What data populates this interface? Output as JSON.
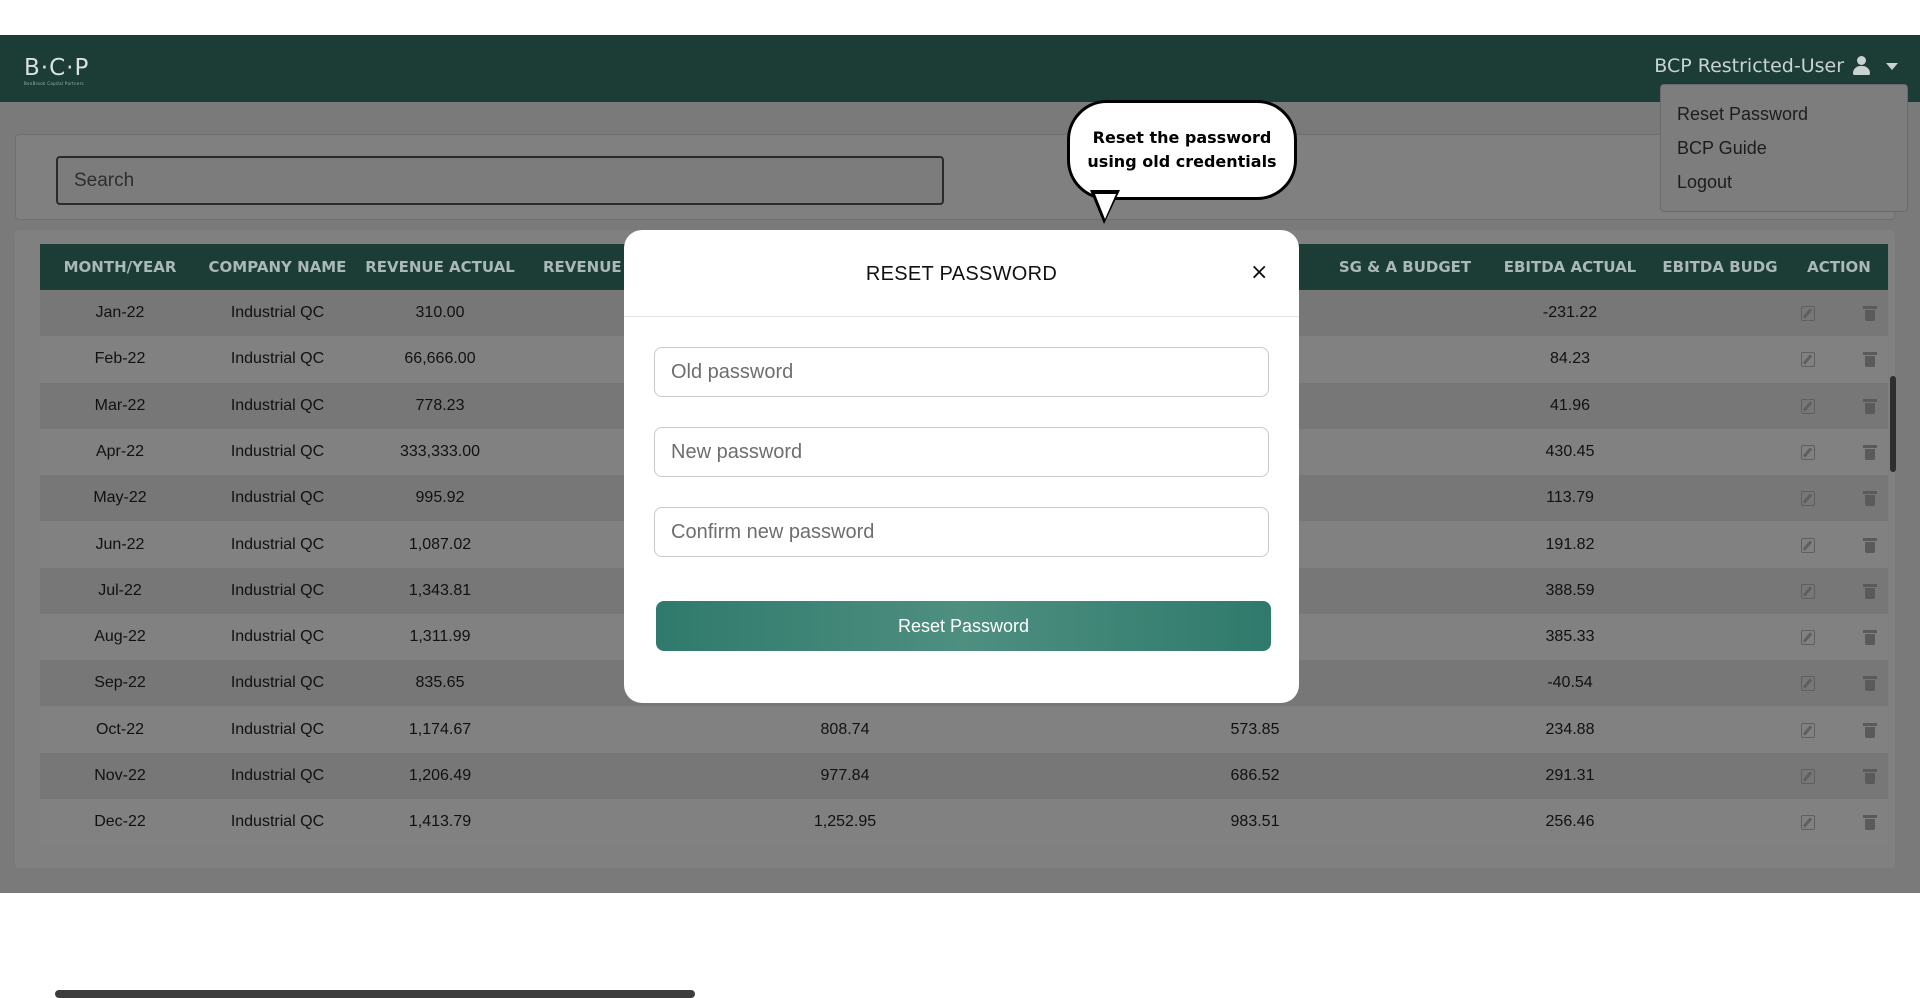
{
  "brand": {
    "logo_text": "B·C·P",
    "logo_subtitle": "BenBrook Capital Partners"
  },
  "user_menu": {
    "user_label": "BCP Restricted-User",
    "items": [
      "Reset Password",
      "BCP Guide",
      "Logout"
    ]
  },
  "search": {
    "placeholder": "Search"
  },
  "table": {
    "headers": [
      "MONTH/YEAR",
      "COMPANY NAME",
      "REVENUE ACTUAL",
      "REVENUE",
      "SG & A BUDGET",
      "EBITDA ACTUAL",
      "EBITDA BUDG",
      "ACTION"
    ],
    "rows": [
      {
        "month": "Jan-22",
        "company": "Industrial QC",
        "revenue_actual": "310.00",
        "col4": "",
        "col5": "",
        "ebitda_actual": "-231.22"
      },
      {
        "month": "Feb-22",
        "company": "Industrial QC",
        "revenue_actual": "66,666.00",
        "col4": "",
        "col5": "",
        "ebitda_actual": "84.23"
      },
      {
        "month": "Mar-22",
        "company": "Industrial QC",
        "revenue_actual": "778.23",
        "col4": "",
        "col5": "",
        "ebitda_actual": "41.96"
      },
      {
        "month": "Apr-22",
        "company": "Industrial QC",
        "revenue_actual": "333,333.00",
        "col4": "",
        "col5": "",
        "ebitda_actual": "430.45"
      },
      {
        "month": "May-22",
        "company": "Industrial QC",
        "revenue_actual": "995.92",
        "col4": "",
        "col5": "",
        "ebitda_actual": "113.79"
      },
      {
        "month": "Jun-22",
        "company": "Industrial QC",
        "revenue_actual": "1,087.02",
        "col4": "",
        "col5": "",
        "ebitda_actual": "191.82"
      },
      {
        "month": "Jul-22",
        "company": "Industrial QC",
        "revenue_actual": "1,343.81",
        "col4": "",
        "col5": "",
        "ebitda_actual": "388.59"
      },
      {
        "month": "Aug-22",
        "company": "Industrial QC",
        "revenue_actual": "1,311.99",
        "col4": "",
        "col5": "",
        "ebitda_actual": "385.33"
      },
      {
        "month": "Sep-22",
        "company": "Industrial QC",
        "revenue_actual": "835.65",
        "col4": "",
        "col5": "",
        "ebitda_actual": "-40.54"
      },
      {
        "month": "Oct-22",
        "company": "Industrial QC",
        "revenue_actual": "1,174.67",
        "col4": "808.74",
        "col5": "573.85",
        "ebitda_actual": "234.88"
      },
      {
        "month": "Nov-22",
        "company": "Industrial QC",
        "revenue_actual": "1,206.49",
        "col4": "977.84",
        "col5": "686.52",
        "ebitda_actual": "291.31"
      },
      {
        "month": "Dec-22",
        "company": "Industrial QC",
        "revenue_actual": "1,413.79",
        "col4": "1,252.95",
        "col5": "983.51",
        "ebitda_actual": "256.46"
      }
    ]
  },
  "modal": {
    "title": "RESET PASSWORD",
    "close_glyph": "×",
    "old_password_placeholder": "Old password",
    "new_password_placeholder": "New password",
    "confirm_password_placeholder": "Confirm new password",
    "submit_label": "Reset Password"
  },
  "callout": {
    "text": "Reset the password using old credentials"
  },
  "icons": [
    "user-icon",
    "caret-down-icon",
    "edit-icon",
    "trash-icon",
    "close-icon"
  ],
  "colors": {
    "navbar": "#1c3c36",
    "button": "#3e8576",
    "overlay": "#7a7a7a"
  }
}
